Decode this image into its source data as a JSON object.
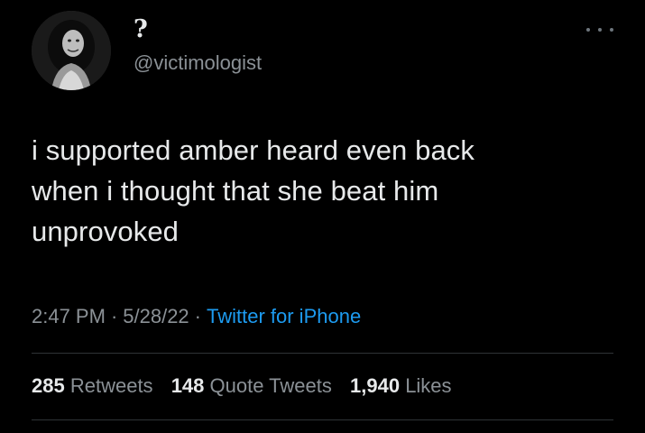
{
  "tweet": {
    "display_name": "?",
    "handle": "@victimologist",
    "text": "i supported amber heard even back\nwhen i thought that she beat him\nunprovoked",
    "time": "2:47 PM",
    "date": "5/28/22",
    "source": "Twitter for iPhone",
    "separator": "·",
    "more_icon": "more-horizontal-icon",
    "stats": {
      "retweets_count": "285",
      "retweets_label": "Retweets",
      "quotes_count": "148",
      "quotes_label": "Quote Tweets",
      "likes_count": "1,940",
      "likes_label": "Likes"
    }
  },
  "colors": {
    "background": "#000000",
    "text_primary": "#e7e9ea",
    "text_secondary": "#8b9196",
    "link": "#1d9bf0",
    "divider": "#2f3336"
  }
}
